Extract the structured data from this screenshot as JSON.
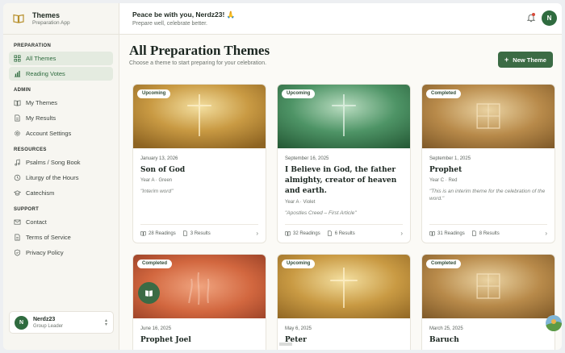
{
  "app": {
    "name": "Themes",
    "subtitle": "Preparation App"
  },
  "sidebar": {
    "sections": [
      {
        "label": "PREPARATION",
        "items": [
          {
            "label": "All Themes",
            "icon": "grid-icon",
            "active": true
          },
          {
            "label": "Reading Votes",
            "icon": "bar-chart-icon"
          }
        ]
      },
      {
        "label": "ADMIN",
        "items": [
          {
            "label": "My Themes",
            "icon": "book-icon"
          },
          {
            "label": "My Results",
            "icon": "document-icon"
          },
          {
            "label": "Account Settings",
            "icon": "gear-icon"
          }
        ]
      },
      {
        "label": "RESOURCES",
        "items": [
          {
            "label": "Psalms / Song Book",
            "icon": "music-icon"
          },
          {
            "label": "Liturgy of the Hours",
            "icon": "clock-icon"
          },
          {
            "label": "Catechism",
            "icon": "cap-icon"
          }
        ]
      },
      {
        "label": "SUPPORT",
        "items": [
          {
            "label": "Contact",
            "icon": "mail-icon"
          },
          {
            "label": "Terms of Service",
            "icon": "document-icon"
          },
          {
            "label": "Privacy Policy",
            "icon": "shield-icon"
          }
        ]
      }
    ]
  },
  "user": {
    "initial": "N",
    "name": "Nerdz23",
    "role": "Group Leader"
  },
  "header": {
    "greeting": "Peace be with you, Nerdz23! 🙏",
    "subtitle": "Prepare well, celebrate better."
  },
  "main": {
    "title": "All Preparation Themes",
    "subtitle": "Choose a theme to start preparing for your celebration.",
    "new_button": "New Theme"
  },
  "cards": [
    {
      "status": "Upcoming",
      "date": "January 13, 2026",
      "title": "Son of God",
      "meta": "Year A · Green",
      "quote": "\"Interim word\"",
      "readings": "28 Readings",
      "results": "3 Results"
    },
    {
      "status": "Upcoming",
      "date": "September 16, 2025",
      "title": "I Believe in God, the father almighty, creator of heaven and earth.",
      "meta": "Year A · Violet",
      "quote": "\"Apostles Creed – First Article\"",
      "readings": "32 Readings",
      "results": "6 Results"
    },
    {
      "status": "Completed",
      "date": "September 1, 2025",
      "title": "Prophet",
      "meta": "Year C · Red",
      "quote": "\"This is an interim theme for the celebration of the word.\"",
      "readings": "31 Readings",
      "results": "8 Results"
    },
    {
      "status": "Completed",
      "date": "June 16, 2025",
      "title": "Prophet Joel"
    },
    {
      "status": "Upcoming",
      "date": "May 6, 2025",
      "title": "Peter"
    },
    {
      "status": "Completed",
      "date": "March 25, 2025",
      "title": "Baruch"
    }
  ],
  "colors": {
    "accent": "#3b6b45",
    "active_bg": "#e4ebe0",
    "notification": "#d64a3a"
  }
}
